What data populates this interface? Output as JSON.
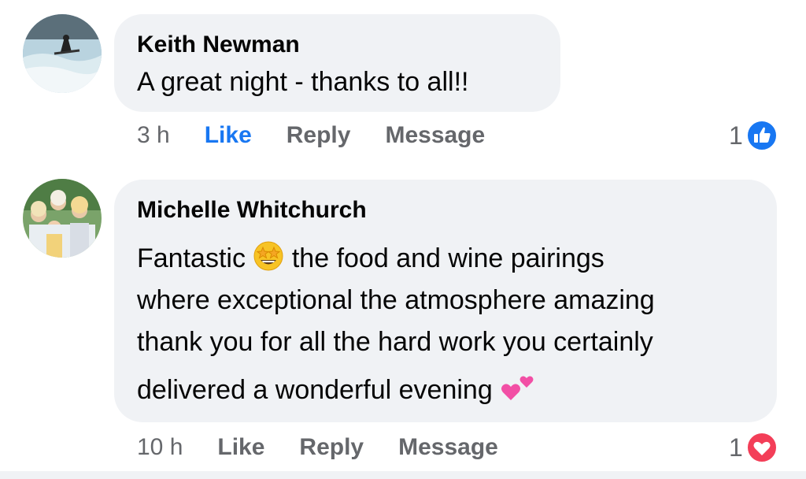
{
  "comments": [
    {
      "author": "Keith Newman",
      "text_lines": [
        "A great night - thanks to all!!"
      ],
      "time": "3 h",
      "actions": {
        "like": "Like",
        "reply": "Reply",
        "message": "Message"
      },
      "liked": true,
      "reaction": {
        "count": "1",
        "icon": "like-icon",
        "color": "#1877f2"
      }
    },
    {
      "author": "Michelle Whitchurch",
      "text_parts": {
        "line1_a": "Fantastic",
        "line1_b": "the food and wine pairings",
        "line2": "where exceptional the atmosphere amazing",
        "line3": "thank you for all the hard work you certainly",
        "line4": "delivered a wonderful evening"
      },
      "emojis": [
        "star-struck-emoji",
        "two-hearts-emoji"
      ],
      "time": "10 h",
      "actions": {
        "like": "Like",
        "reply": "Reply",
        "message": "Message"
      },
      "liked": false,
      "reaction": {
        "count": "1",
        "icon": "love-icon",
        "color": "#f33e58"
      }
    }
  ],
  "colors": {
    "bubble": "#f0f2f5",
    "secondary_text": "#65676b",
    "accent": "#1877f2",
    "love": "#f33e58"
  }
}
